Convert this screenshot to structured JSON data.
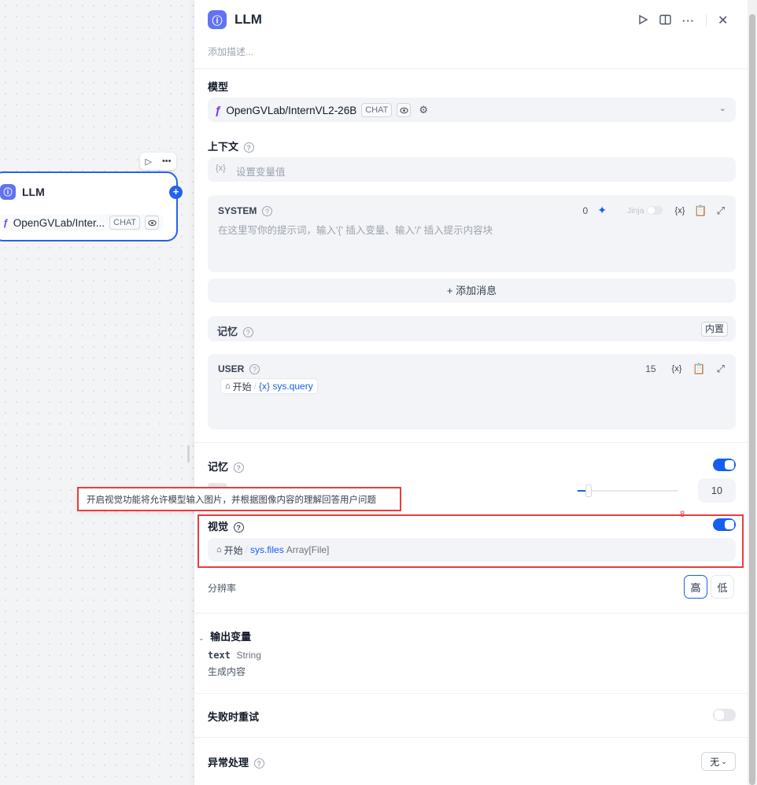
{
  "canvas": {
    "node": {
      "title": "LLM",
      "model": "OpenGVLab/Inter...",
      "mode_tag": "CHAT"
    }
  },
  "panel": {
    "title": "LLM",
    "description_placeholder": "添加描述...",
    "model_section": {
      "label": "模型",
      "model_name": "OpenGVLab/InternVL2-26B",
      "mode_tag": "CHAT"
    },
    "context_section": {
      "label": "上下文",
      "var_icon": "{x}",
      "placeholder": "设置变量值"
    },
    "system_prompt": {
      "label": "SYSTEM",
      "count": "0",
      "jinja_label": "Jinja",
      "var_icon": "{x}",
      "placeholder": "在这里写你的提示词，输入'{' 插入变量、输入'/' 插入提示内容块"
    },
    "add_message_label": "+ 添加消息",
    "memory_row": {
      "label": "记忆",
      "badge": "内置"
    },
    "user_prompt": {
      "label": "USER",
      "count": "15",
      "var_icon": "{x}",
      "chip_source": "开始",
      "chip_separator": "/",
      "chip_var": "{x} sys.query"
    },
    "memory_toggle": {
      "label": "记忆",
      "enabled": true,
      "window_value": "10"
    },
    "tooltip": "开启视觉功能将允许模型输入图片，并根据图像内容的理解回答用户问题",
    "vision": {
      "label": "视觉",
      "enabled": true,
      "red_marker": "8",
      "chip_source": "开始",
      "chip_separator": "/",
      "chip_var": "sys.files",
      "chip_type": "Array[File]"
    },
    "resolution": {
      "label": "分辨率",
      "high": "高",
      "low": "低",
      "selected": "高"
    },
    "output_vars": {
      "label": "输出变量",
      "var_name": "text",
      "var_type": "String",
      "var_desc": "生成内容"
    },
    "retry": {
      "label": "失败时重试",
      "enabled": false
    },
    "error_handling": {
      "label": "异常处理",
      "value": "无"
    }
  },
  "colors": {
    "accent": "#155eef",
    "node_icon": "#6172f3",
    "highlight": "#e53e3e"
  }
}
